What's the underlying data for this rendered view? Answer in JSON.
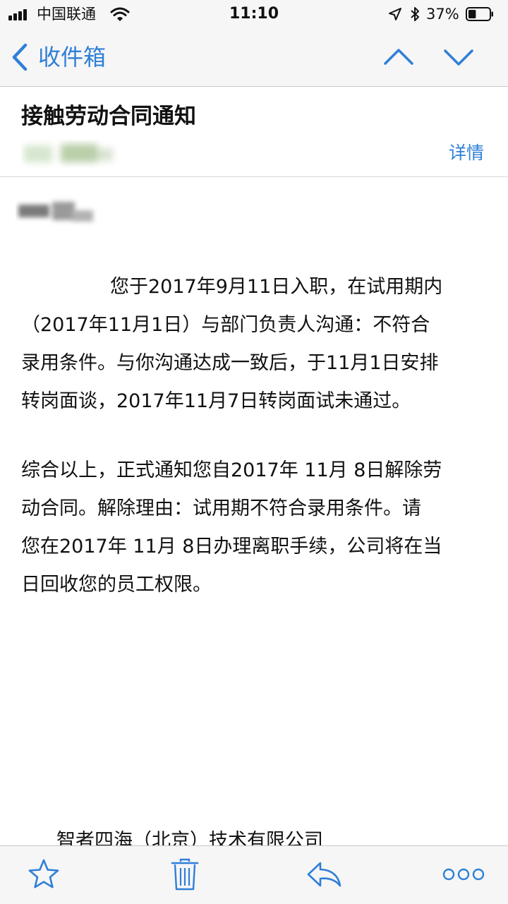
{
  "status_bar": {
    "carrier": "中国联通",
    "time": "11:10",
    "battery_percent": "37%",
    "battery_level": 0.37,
    "icons": [
      "signal-icon",
      "wifi-icon",
      "location-icon",
      "bluetooth-icon",
      "battery-icon"
    ]
  },
  "nav": {
    "back_label": "收件箱",
    "icons": [
      "chevron-left-icon",
      "chevron-up-icon",
      "chevron-down-icon"
    ]
  },
  "email": {
    "subject": "接触劳动合同通知",
    "details_label": "详情",
    "paragraph1": [
      "您于2017年9月11日入职，在试用期内",
      "（2017年11月1日）与部门负责人沟通：不符合",
      "录用条件。与你沟通达成一致后，于11月1日安排",
      "转岗面谈，2017年11月7日转岗面试未通过。"
    ],
    "paragraph2": [
      "综合以上，正式通知您自2017年 11月 8日解除劳",
      "动合同。解除理由：试用期不符合录用条件。请",
      "您在2017年 11月 8日办理离职手续，公司将在当",
      "日回收您的员工权限。"
    ],
    "company": "智者四海（北京）技术有限公司"
  },
  "toolbar": {
    "icons": [
      "star-icon",
      "trash-icon",
      "reply-icon",
      "more-icon"
    ]
  },
  "colors": {
    "accent": "#2f7fd6",
    "bar_background": "#f6f6f7",
    "text": "#111111"
  }
}
